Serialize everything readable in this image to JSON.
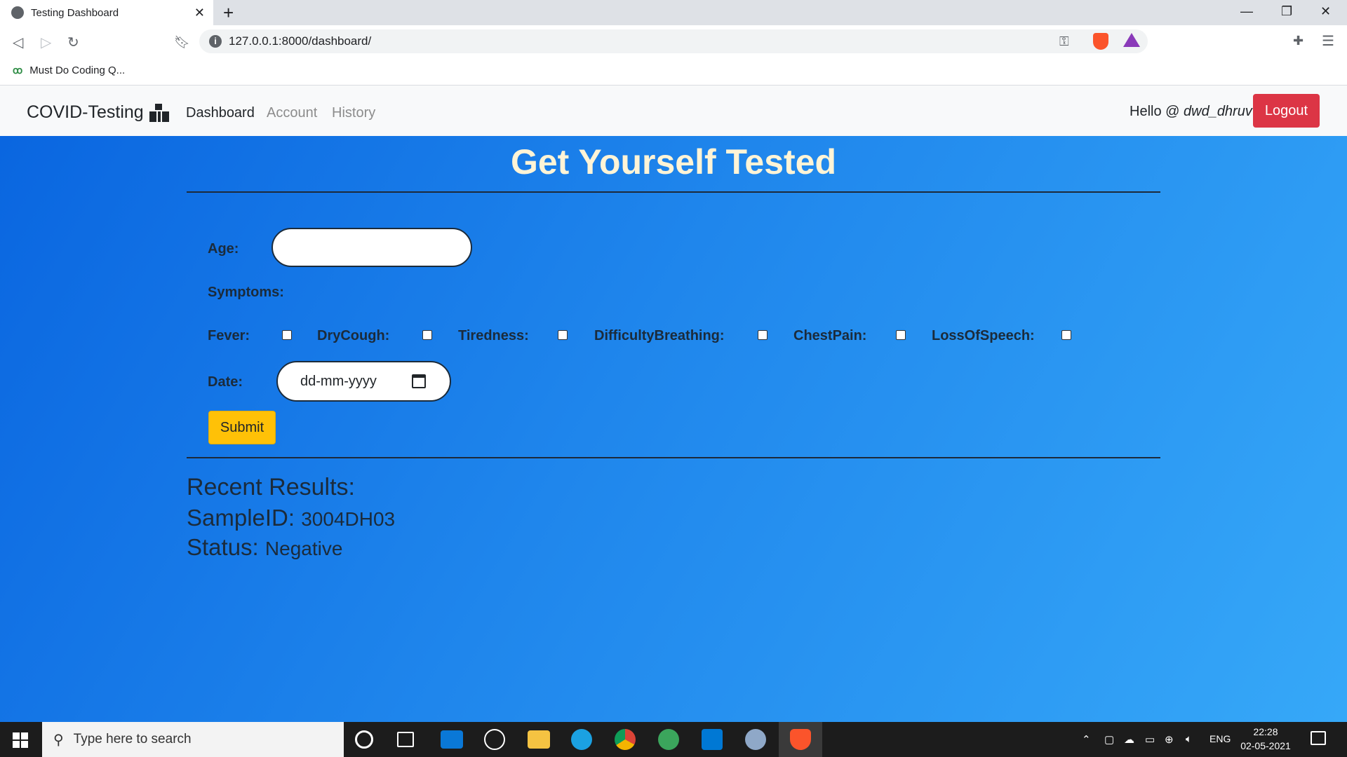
{
  "browser": {
    "tab_title": "Testing Dashboard",
    "tab_close": "✕",
    "new_tab": "+",
    "url": "127.0.0.1:8000/dashboard/",
    "bookmark": "Must Do Coding Q...",
    "bookmark_logo": "ꝏ"
  },
  "navbar": {
    "brand": "COVID-Testing",
    "links": [
      "Dashboard",
      "Account",
      "History"
    ],
    "hello_prefix": "Hello @ ",
    "username": "dwd_dhruv",
    "logout": "Logout"
  },
  "form": {
    "title": "Get Yourself Tested",
    "age_label": "Age:",
    "symptoms_label": "Symptoms:",
    "symptoms": [
      "Fever:",
      "DryCough:",
      "Tiredness:",
      "DifficultyBreathing:",
      "ChestPain:",
      "LossOfSpeech:"
    ],
    "date_label": "Date:",
    "date_placeholder": "dd-mm-yyyy",
    "submit": "Submit"
  },
  "results": {
    "title": "Recent Results:",
    "sample_key": "SampleID:",
    "sample_value": "3004DH03",
    "status_key": "Status:",
    "status_value": "Negative"
  },
  "taskbar": {
    "search_placeholder": "Type here to search",
    "lang": "ENG",
    "time": "22:28",
    "date": "02-05-2021"
  },
  "colors": {
    "logout": "#dc3545",
    "submit": "#ffc107",
    "gradient_start": "#0a66e0",
    "gradient_end": "#36a8f8"
  }
}
